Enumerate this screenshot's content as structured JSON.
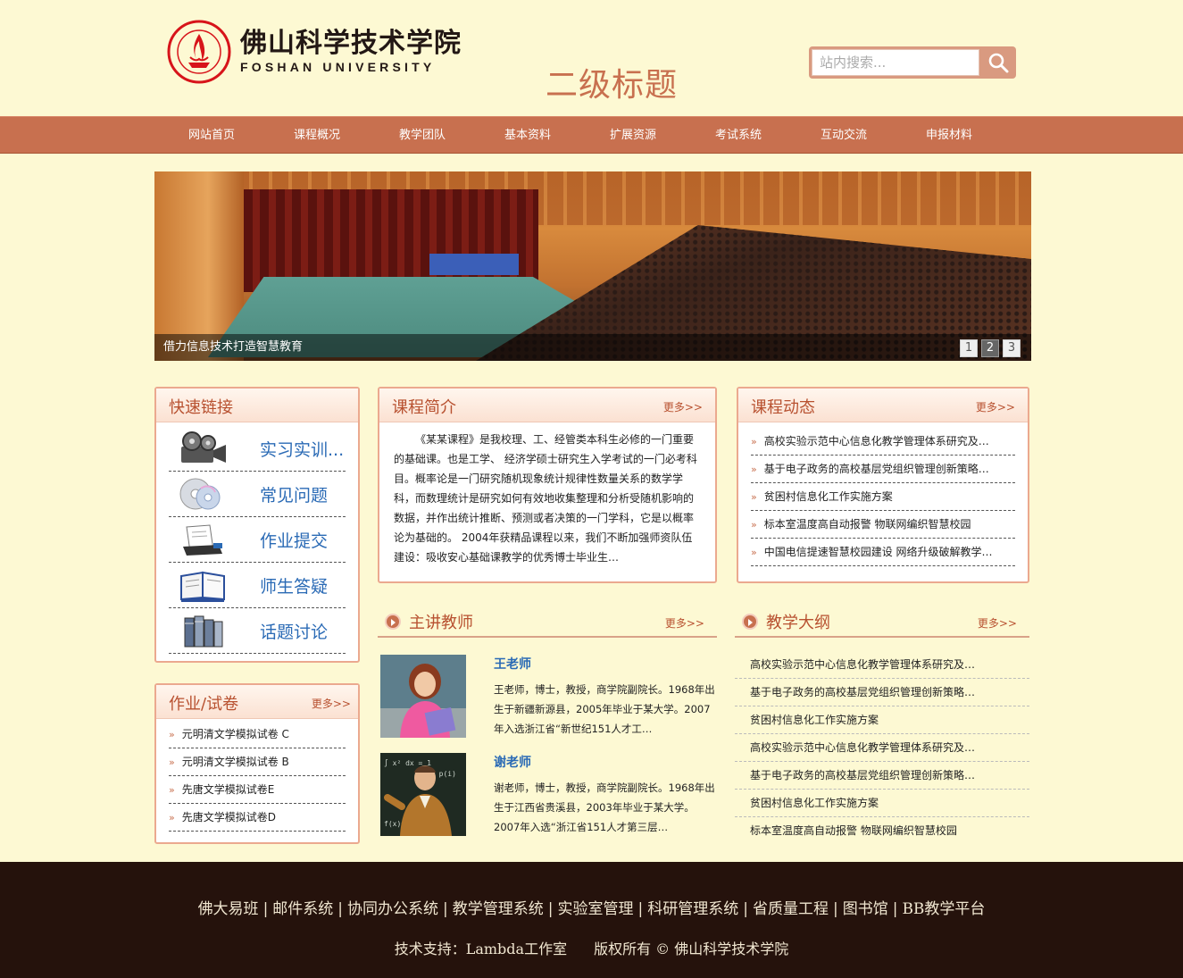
{
  "header": {
    "logo_cn": "佛山科学技术学院",
    "logo_en": "FOSHAN UNIVERSITY",
    "page_title": "二级标题",
    "search_placeholder": "站内搜索..."
  },
  "nav": [
    "网站首页",
    "课程概况",
    "教学团队",
    "基本资料",
    "扩展资源",
    "考试系统",
    "互动交流",
    "申报材料"
  ],
  "banner": {
    "caption": "借力信息技术打造智慧教育",
    "pages": [
      "1",
      "2",
      "3"
    ],
    "active_page": "2"
  },
  "quick_links": {
    "title": "快速链接",
    "items": [
      {
        "label": "实习实训...",
        "icon": "film-reel-icon"
      },
      {
        "label": "常见问题",
        "icon": "cd-disc-icon"
      },
      {
        "label": "作业提交",
        "icon": "document-tray-icon"
      },
      {
        "label": "师生答疑",
        "icon": "open-book-icon"
      },
      {
        "label": "话题讨论",
        "icon": "books-icon"
      }
    ]
  },
  "exams": {
    "title": "作业/试卷",
    "more": "更多>>",
    "items": [
      "元明清文学模拟试卷 C",
      "元明清文学模拟试卷 B",
      "先唐文学模拟试卷E",
      "先唐文学模拟试卷D"
    ]
  },
  "intro": {
    "title": "课程简介",
    "more": "更多>>",
    "text": "《某某课程》是我校理、工、经管类本科生必修的一门重要的基础课。也是工学、 经济学硕士研究生入学考试的一门必考科目。概率论是一门研究随机现象统计规律性数量关系的数学学科，而数理统计是研究如何有效地收集整理和分析受随机影响的数据，并作出统计推断、预测或者决策的一门学科，它是以概率论为基础的。 2004年获精品课程以来，我们不断加强师资队伍建设：吸收安心基础课教学的优秀博士毕业生…"
  },
  "news": {
    "title": "课程动态",
    "more": "更多>>",
    "items": [
      "高校实验示范中心信息化教学管理体系研究及…",
      "基于电子政务的高校基层党组织管理创新策略…",
      "贫困村信息化工作实施方案",
      "标本室温度高自动报警 物联网编织智慧校园",
      "中国电信提速智慧校园建设 网络升级破解教学…"
    ]
  },
  "teachers": {
    "title": "主讲教师",
    "more": "更多>>",
    "items": [
      {
        "name": "王老师",
        "desc": "王老师，博士，教授，商学院副院长。1968年出生于新疆新源县，2005年毕业于某大学。2007年入选浙江省“新世纪151人才工…"
      },
      {
        "name": "谢老师",
        "desc": "谢老师，博士，教授，商学院副院长。1968年出生于江西省贵溪县，2003年毕业于某大学。2007年入选“浙江省151人才第三层…"
      }
    ]
  },
  "syllabus": {
    "title": "教学大纲",
    "more": "更多>>",
    "items": [
      "高校实验示范中心信息化教学管理体系研究及…",
      "基于电子政务的高校基层党组织管理创新策略…",
      "贫困村信息化工作实施方案",
      "高校实验示范中心信息化教学管理体系研究及…",
      "基于电子政务的高校基层党组织管理创新策略…",
      "贫困村信息化工作实施方案",
      "标本室温度高自动报警 物联网编织智慧校园"
    ]
  },
  "footer": {
    "links": [
      "佛大易班",
      "邮件系统",
      "协同办公系统",
      "教学管理系统",
      "实验室管理",
      "科研管理系统",
      "省质量工程",
      "图书馆",
      "BB教学平台"
    ],
    "tech_support": "技术支持：Lambda工作室",
    "copyright": "版权所有 © 佛山科学技术学院"
  },
  "colors": {
    "background": "#fdf9d3",
    "accent": "#c8704f",
    "link_blue": "#2a6ab5",
    "footer": "#25120c"
  }
}
